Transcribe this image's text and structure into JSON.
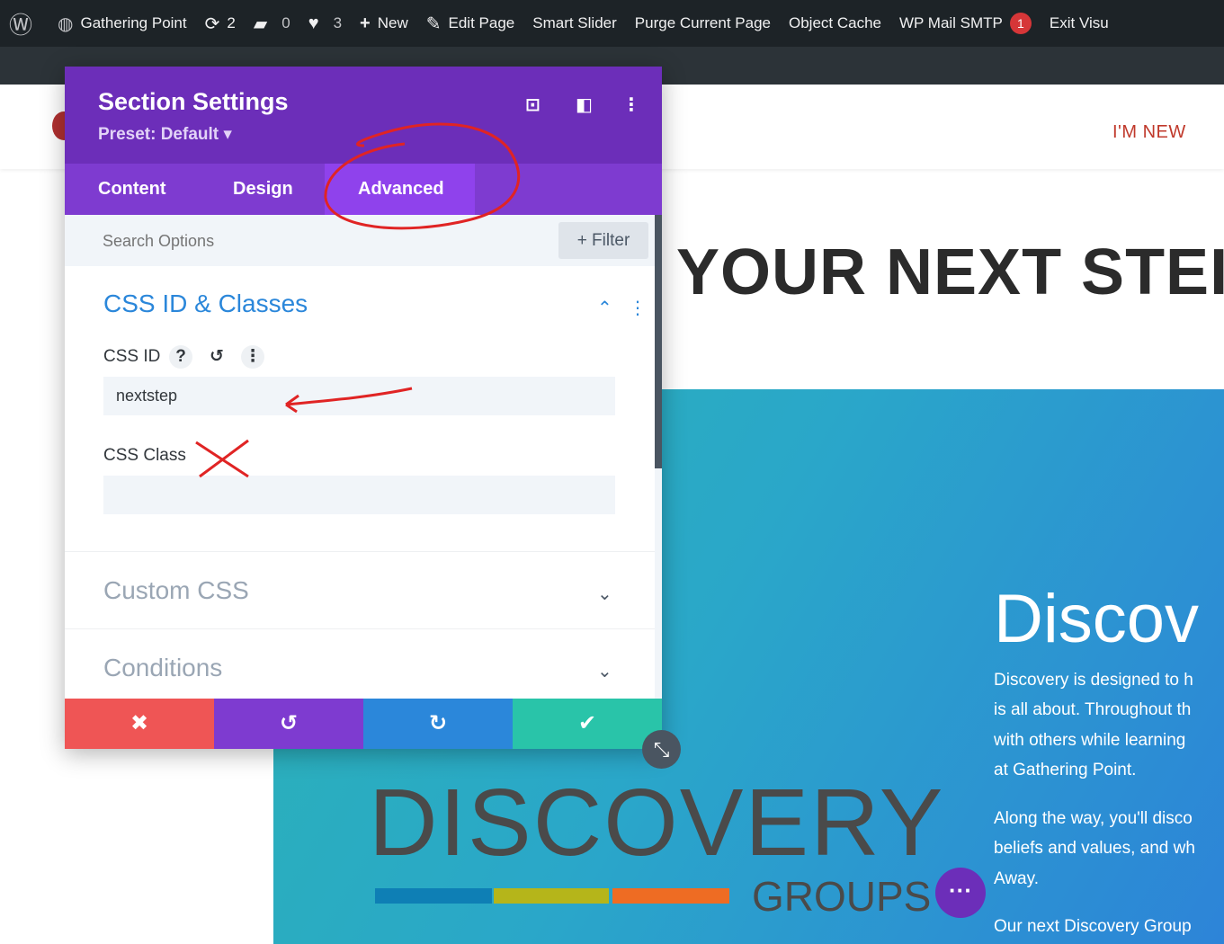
{
  "adminbar": {
    "site": "Gathering Point",
    "updates": "2",
    "comments": "0",
    "likes": "3",
    "new": "New",
    "edit_page": "Edit Page",
    "smart_slider": "Smart Slider",
    "purge": "Purge Current Page",
    "object_cache": "Object Cache",
    "wp_mail": "WP Mail SMTP",
    "wp_mail_badge": "1",
    "exit": "Exit Visu"
  },
  "site": {
    "nav_new": "I'M NEW",
    "headline": "YOUR NEXT STEI",
    "disc_title": "Discov",
    "paragraphs": [
      "Discovery is designed to h",
      "is all about. Throughout th",
      "with others while learning",
      "at Gathering Point.",
      "Along the way, you'll disco",
      "beliefs and values, and wh",
      "Away.",
      "Our next Discovery Group"
    ],
    "logo_text": "DISCOVERY",
    "logo_groups": "GROUPS",
    "logo_colors": [
      "#0e7fb5",
      "#b5b51a",
      "#ee6c23"
    ]
  },
  "panel": {
    "title": "Section Settings",
    "preset": "Preset: Default ▾",
    "tabs": [
      {
        "label": "Content",
        "active": false
      },
      {
        "label": "Design",
        "active": false
      },
      {
        "label": "Advanced",
        "active": true
      }
    ],
    "search_placeholder": "Search Options",
    "filter": "+ Filter",
    "sections": {
      "css_id_classes": {
        "title": "CSS ID & Classes",
        "css_id_label": "CSS ID",
        "css_id_value": "nextstep",
        "css_class_label": "CSS Class",
        "css_class_value": ""
      },
      "custom_css": "Custom CSS",
      "conditions": "Conditions"
    },
    "colors": {
      "header": "#6c2eb9",
      "tabs": "#7e3bd0",
      "active_tab": "#8f42ec",
      "cancel": "#ef5555",
      "undo": "#7e3bd0",
      "redo": "#2b87da",
      "save": "#29c4a9"
    }
  }
}
